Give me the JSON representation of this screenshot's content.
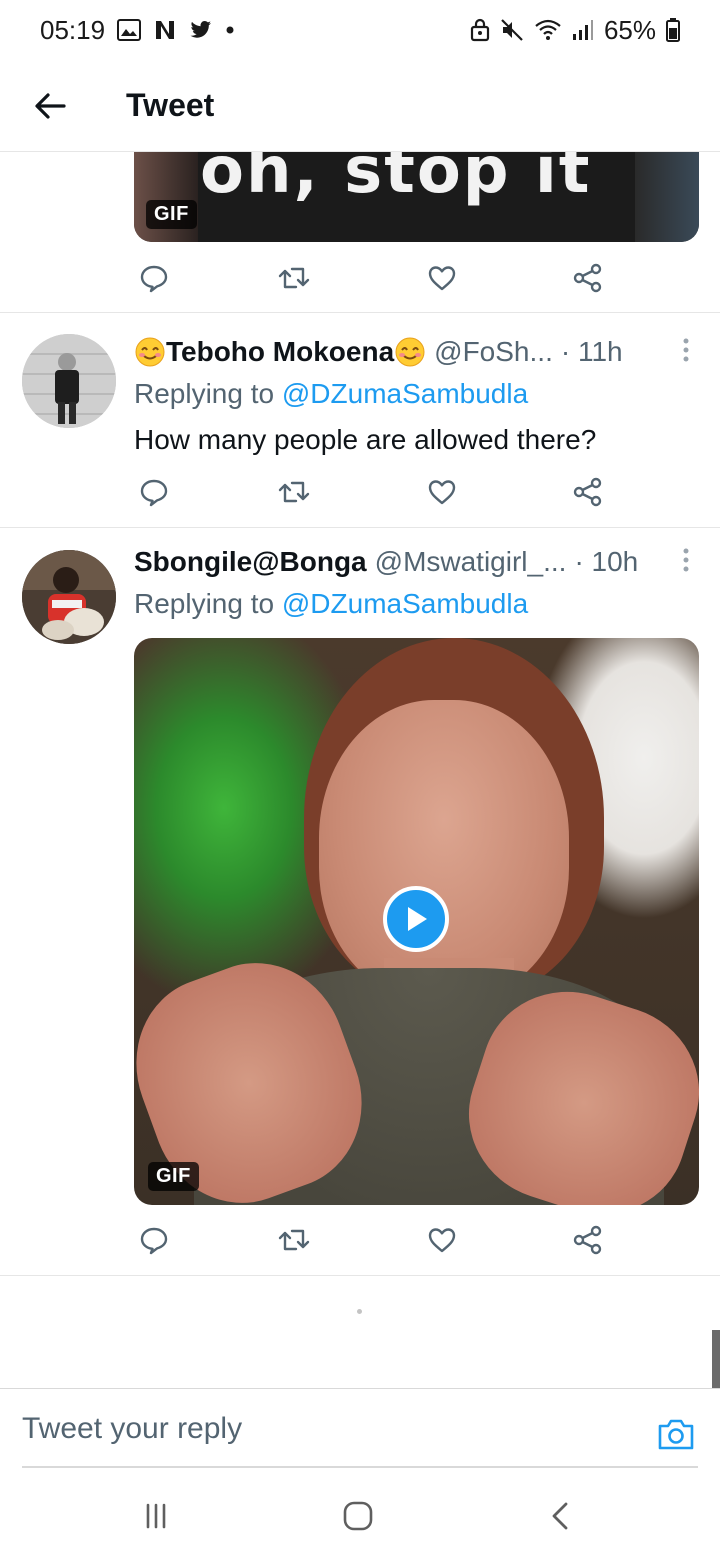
{
  "status_bar": {
    "time": "05:19",
    "battery": "65%",
    "icons_left": [
      "gallery-icon",
      "netflix-icon",
      "twitter-icon",
      "dot-icon"
    ],
    "icons_right": [
      "lock-icon",
      "mute-icon",
      "wifi-icon",
      "signal-icon",
      "battery-icon"
    ]
  },
  "header": {
    "title": "Tweet"
  },
  "top_gif": {
    "caption": "oh, stop it",
    "badge": "GIF"
  },
  "tweets": [
    {
      "display_name": "Teboho Mokoena",
      "handle": "@FoSh...",
      "time": "· 11h",
      "reply_prefix": "Replying to ",
      "reply_to": "@DZumaSambudla",
      "text": "How many people are allowed there?"
    },
    {
      "display_name": "Sbongile@Bonga",
      "handle": "@Mswatigirl_...",
      "time": "· 10h",
      "reply_prefix": "Replying to ",
      "reply_to": "@DZumaSambudla",
      "media_badge": "GIF"
    }
  ],
  "reply_box": {
    "placeholder": "Tweet your reply"
  },
  "colors": {
    "accent": "#1d9bf0",
    "secondary_text": "#536471",
    "primary_text": "#0f1419",
    "divider": "#e6e6e6"
  }
}
